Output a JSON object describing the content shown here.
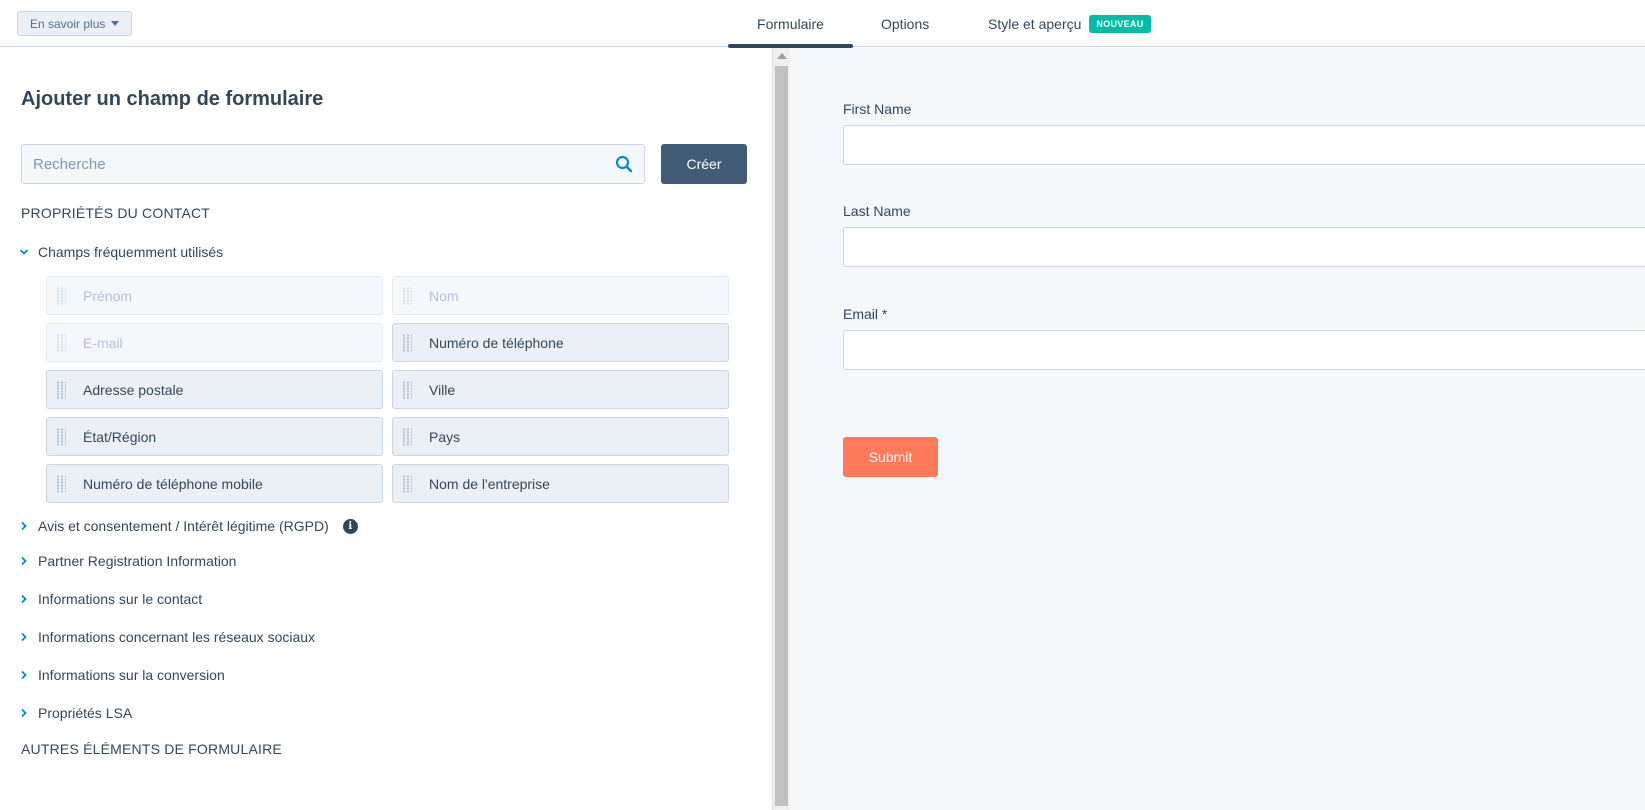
{
  "topbar": {
    "learn_more": "En savoir plus",
    "tabs": [
      {
        "label": "Formulaire"
      },
      {
        "label": "Options"
      },
      {
        "label": "Style et aperçu",
        "badge": "NOUVEAU"
      }
    ],
    "active_tab": "Formulaire"
  },
  "left": {
    "title": "Ajouter un champ de formulaire",
    "search": {
      "placeholder": "Recherche",
      "value": ""
    },
    "create_label": "Créer",
    "contact_section": "PROPRIÉTÉS DU CONTACT",
    "expanded_group": "Champs fréquemment utilisés",
    "fields": [
      {
        "label": "Prénom",
        "disabled": true
      },
      {
        "label": "Nom",
        "disabled": true
      },
      {
        "label": "E-mail",
        "disabled": true
      },
      {
        "label": "Numéro de téléphone",
        "disabled": false
      },
      {
        "label": "Adresse postale",
        "disabled": false
      },
      {
        "label": "Ville",
        "disabled": false
      },
      {
        "label": "État/Région",
        "disabled": false
      },
      {
        "label": "Pays",
        "disabled": false
      },
      {
        "label": "Numéro de téléphone mobile",
        "disabled": false
      },
      {
        "label": "Nom de l'entreprise",
        "disabled": false
      }
    ],
    "groups": [
      {
        "label": "Avis et consentement / Intérêt légitime (RGPD)",
        "info": true
      },
      {
        "label": "Partner Registration Information"
      },
      {
        "label": "Informations sur le contact"
      },
      {
        "label": "Informations concernant les réseaux sociaux"
      },
      {
        "label": "Informations sur la conversion"
      },
      {
        "label": "Propriétés LSA"
      }
    ],
    "other_section": "AUTRES ÉLÉMENTS DE FORMULAIRE"
  },
  "preview": {
    "fields": [
      {
        "label": "First Name"
      },
      {
        "label": "Last Name"
      },
      {
        "label": "Email *"
      }
    ],
    "submit_label": "Submit"
  },
  "colors": {
    "primary_dark": "#425b76",
    "text": "#33475b",
    "accent_orange": "#ff7a59",
    "badge_green": "#00bda5",
    "preview_bg": "#f5f8fa"
  }
}
